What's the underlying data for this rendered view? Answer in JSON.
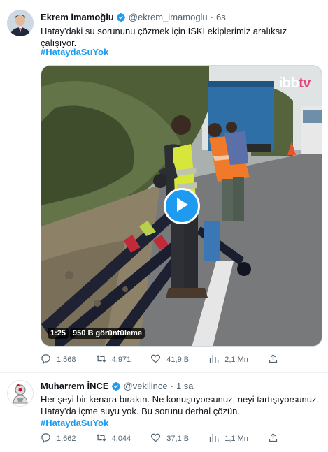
{
  "tweets": [
    {
      "author_name": "Ekrem İmamoğlu",
      "handle": "@ekrem_imamoglu",
      "time": "6s",
      "text": "Hatay'daki su sorununu çözmek için İSKİ ekiplerimiz aralıksız çalışıyor.",
      "hashtag": "#HataydaSuYok",
      "video": {
        "duration": "1:25",
        "views": "950 B görüntüleme",
        "logo_ibb": "ibb",
        "logo_tv": "tv"
      },
      "stats": {
        "replies": "1.568",
        "retweets": "4.971",
        "likes": "41,9 B",
        "views": "2,1 Mn"
      }
    },
    {
      "author_name": "Muharrem İNCE",
      "handle": "@vekilince",
      "time": "1 sa",
      "text_line1": "Her şeyi bir kenara bırakın. Ne konuşuyorsunuz, neyi tartışıyorsunuz.",
      "text_line2": "Hatay'da içme suyu yok. Bu sorunu derhal çözün.",
      "hashtag": "#HataydaSuYok",
      "stats": {
        "replies": "1.662",
        "retweets": "4.044",
        "likes": "37,1 B",
        "views": "1,1 Mn"
      }
    }
  ],
  "icons": [
    "verified-badge-icon",
    "reply-icon",
    "retweet-icon",
    "like-icon",
    "views-icon",
    "share-icon",
    "play-icon"
  ],
  "colors": {
    "accent": "#1d9bf0",
    "text": "#0f1419",
    "muted": "#536471",
    "logo_tv": "#e0457b"
  }
}
